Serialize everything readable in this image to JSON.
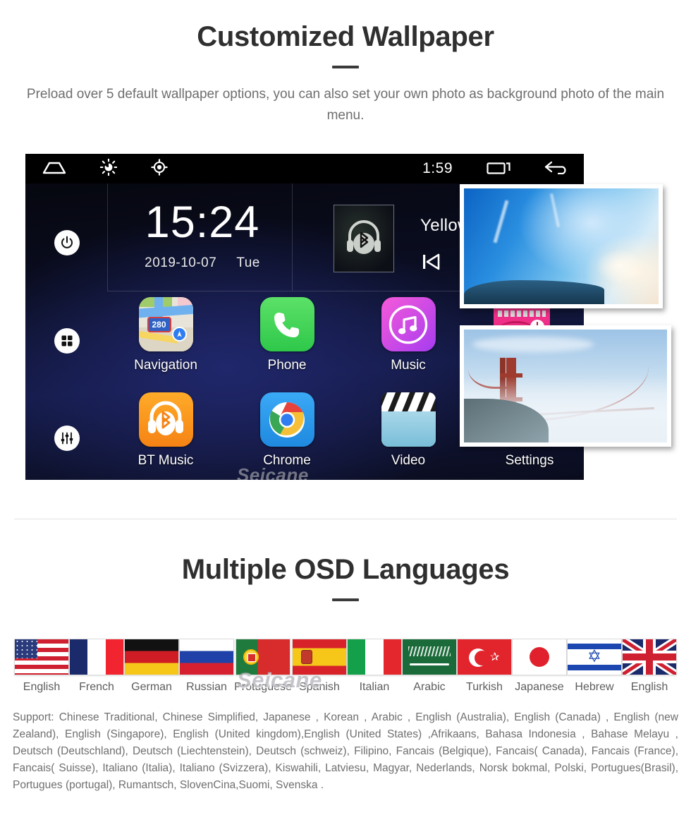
{
  "sections": {
    "wallpaper": {
      "title": "Customized Wallpaper",
      "subtitle": "Preload over 5 default wallpaper options, you can also set your own photo as background photo of the main menu."
    },
    "languages": {
      "title": "Multiple OSD Languages",
      "support_text": "Support: Chinese Traditional, Chinese Simplified, Japanese , Korean , Arabic , English (Australia), English (Canada) , English (new Zealand), English (Singapore), English (United kingdom),English (United States) ,Afrikaans, Bahasa Indonesia , Bahase Melayu , Deutsch (Deutschland), Deutsch (Liechtenstein), Deutsch (schweiz), Filipino, Fancais (Belgique), Fancais( Canada), Fancais (France), Fancais( Suisse), Italiano (Italia), Italiano (Svizzera), Kiswahili, Latviesu, Magyar, Nederlands, Norsk bokmal, Polski, Portugues(Brasil), Portugues (portugal), Rumantsch, SlovenCina,Suomi, Svenska ."
    }
  },
  "head_unit": {
    "status_bar": {
      "home_icon": "home-icon",
      "brightness_icon": "brightness-icon",
      "gps_icon": "gps-icon",
      "time": "1:59",
      "recents_icon": "recent-apps-icon",
      "back_icon": "back-arrow-icon"
    },
    "sidebar": [
      {
        "icon": "power-icon",
        "name": "power-button"
      },
      {
        "icon": "apps-grid-icon",
        "name": "apps-button"
      },
      {
        "icon": "equalizer-icon",
        "name": "equalizer-button"
      }
    ],
    "clock": {
      "time": "15:24",
      "date": "2019-10-07",
      "weekday": "Tue"
    },
    "media": {
      "album_art_icon": "bluetooth-headphones-icon",
      "track_title": "Yellow",
      "prev_icon": "previous-track-icon"
    },
    "apps": [
      {
        "label": "Navigation",
        "icon": "maps-icon",
        "shield": "280"
      },
      {
        "label": "Phone",
        "icon": "phone-icon"
      },
      {
        "label": "Music",
        "icon": "music-note-icon"
      },
      {
        "label": "BT Music",
        "icon": "bluetooth-music-icon"
      },
      {
        "label": "Chrome",
        "icon": "chrome-icon"
      },
      {
        "label": "Video",
        "icon": "clapperboard-icon"
      },
      {
        "label": "Settings",
        "icon": "settings-gear-icon"
      }
    ],
    "wallpaper_thumbs": [
      {
        "name": "ice-cave-wallpaper"
      },
      {
        "name": "pink-radio-wallpaper"
      },
      {
        "name": "golden-gate-bridge-wallpaper"
      }
    ],
    "watermark": "Seicane"
  },
  "flags_watermark": "Seicane",
  "flags": [
    {
      "label": "English",
      "code": "us"
    },
    {
      "label": "French",
      "code": "fr"
    },
    {
      "label": "German",
      "code": "de"
    },
    {
      "label": "Russian",
      "code": "ru"
    },
    {
      "label": "Protuguese",
      "code": "pt"
    },
    {
      "label": "Spanish",
      "code": "es"
    },
    {
      "label": "Italian",
      "code": "it"
    },
    {
      "label": "Arabic",
      "code": "sa"
    },
    {
      "label": "Turkish",
      "code": "tr"
    },
    {
      "label": "Japanese",
      "code": "jp"
    },
    {
      "label": "Hebrew",
      "code": "il"
    },
    {
      "label": "English",
      "code": "gb"
    }
  ],
  "colors": {
    "heading": "#2f2f2f",
    "body_text": "#6e6e6e",
    "unit_background": "#05060d",
    "accent_blue": "#141a45"
  }
}
